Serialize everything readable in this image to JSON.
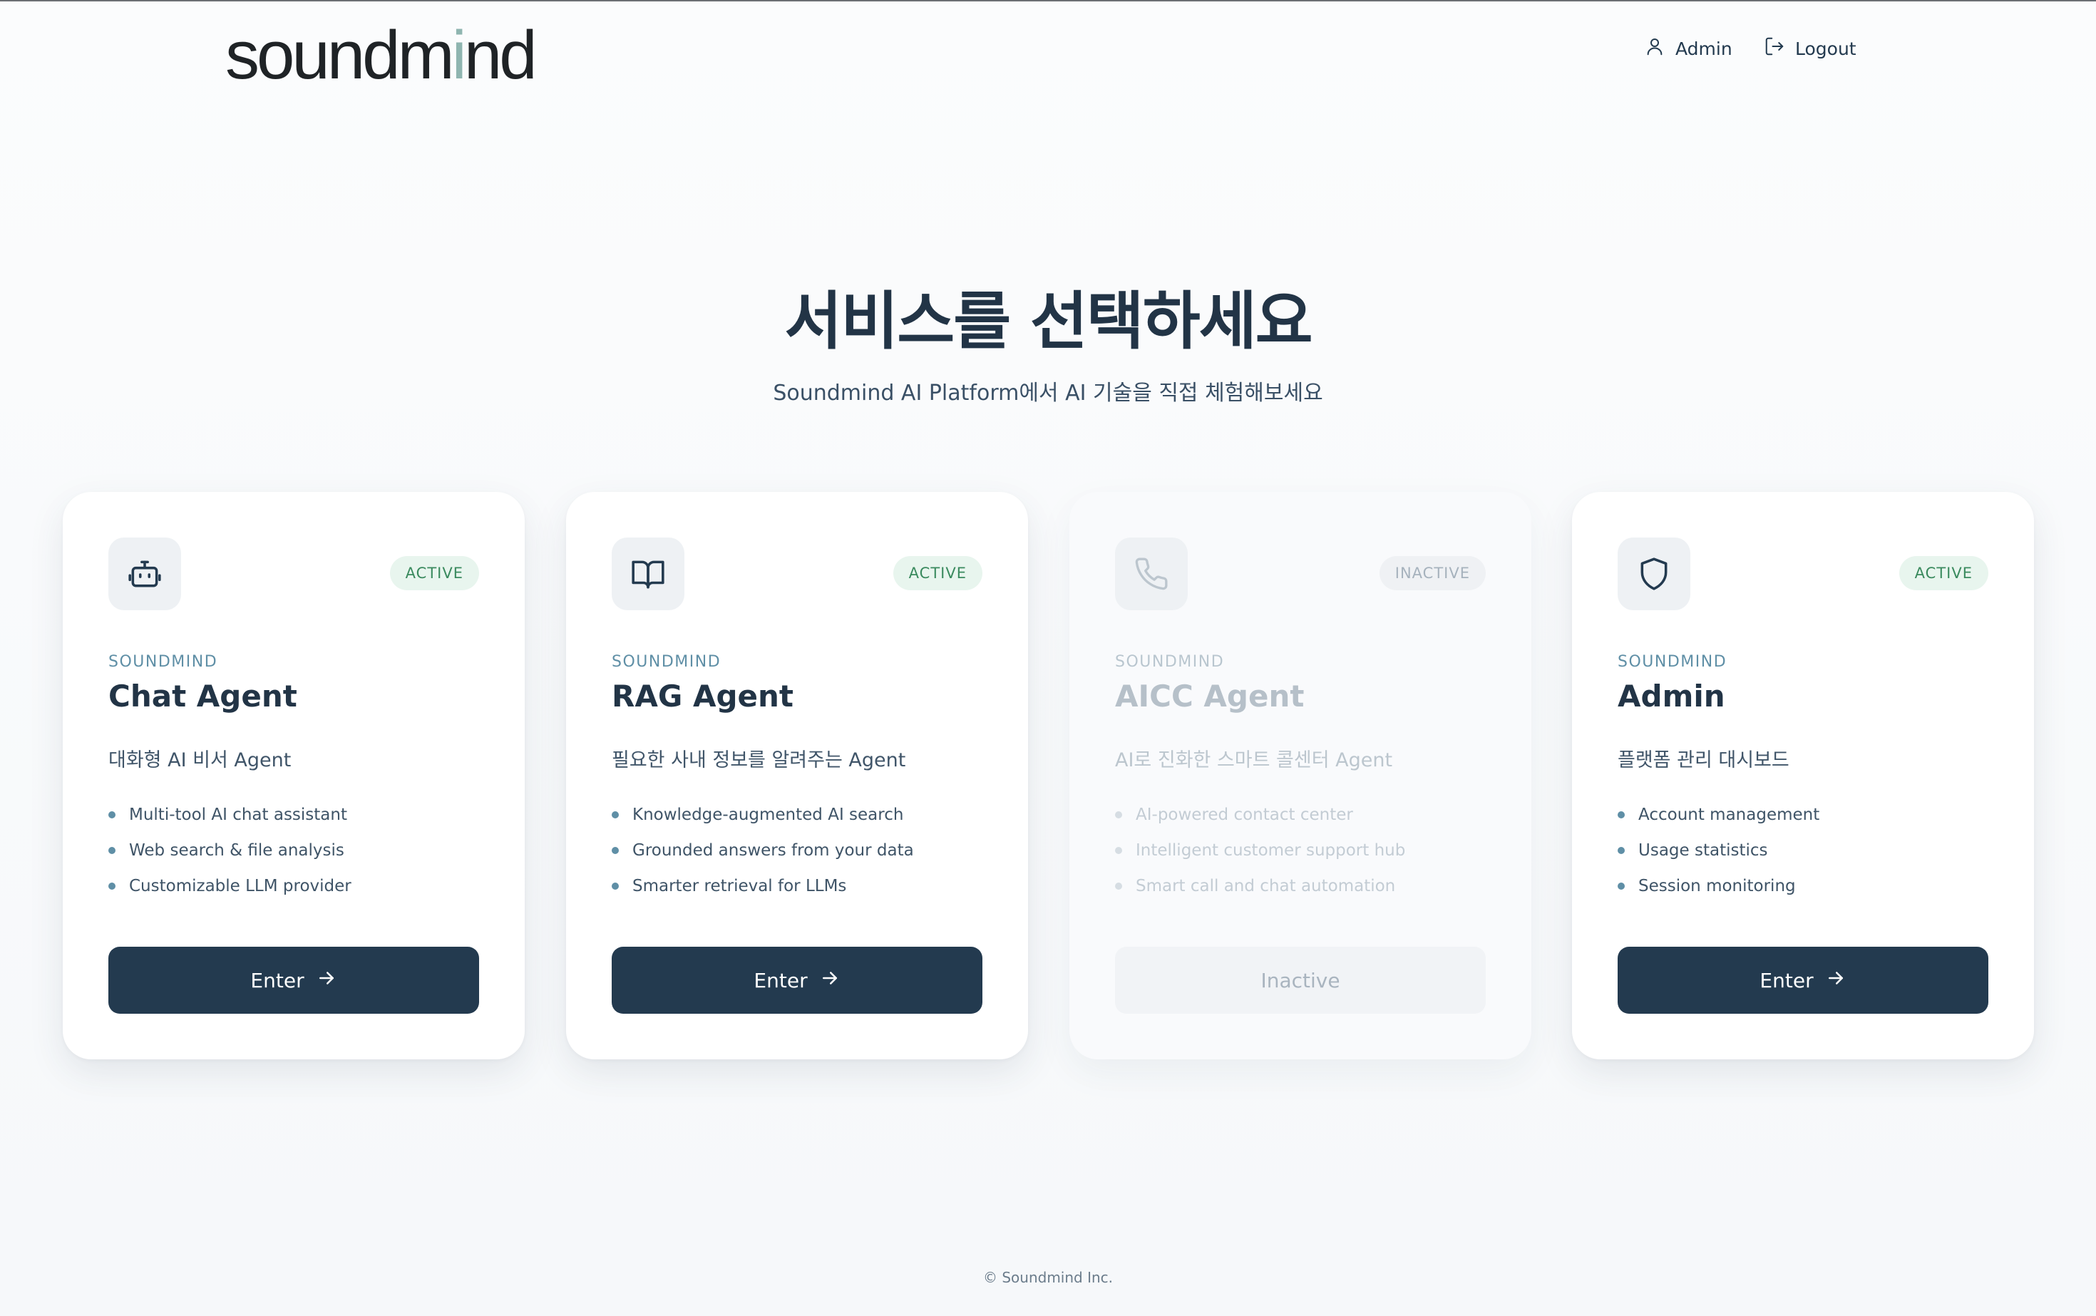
{
  "header": {
    "logo": {
      "part1": "soundm",
      "accent": "i",
      "part2": "nd"
    },
    "nav": {
      "admin": "Admin",
      "logout": "Logout"
    }
  },
  "hero": {
    "title": "서비스를 선택하세요",
    "subtitle": "Soundmind AI Platform에서 AI 기술을 직접 체험해보세요"
  },
  "cards": [
    {
      "icon": "robot-icon",
      "status": "ACTIVE",
      "eyebrow": "SOUNDMIND",
      "title": "Chat Agent",
      "description": "대화형 AI 비서 Agent",
      "features": [
        "Multi-tool AI chat assistant",
        "Web search & file analysis",
        "Customizable LLM provider"
      ],
      "button": "Enter"
    },
    {
      "icon": "book-icon",
      "status": "ACTIVE",
      "eyebrow": "SOUNDMIND",
      "title": "RAG Agent",
      "description": "필요한 사내 정보를 알려주는 Agent",
      "features": [
        "Knowledge-augmented AI search",
        "Grounded answers from your data",
        "Smarter retrieval for LLMs"
      ],
      "button": "Enter"
    },
    {
      "icon": "phone-icon",
      "status": "INACTIVE",
      "eyebrow": "SOUNDMIND",
      "title": "AICC Agent",
      "description": "AI로 진화한 스마트 콜센터 Agent",
      "features": [
        "AI-powered contact center",
        "Intelligent customer support hub",
        "Smart call and chat automation"
      ],
      "button": "Inactive"
    },
    {
      "icon": "shield-icon",
      "status": "ACTIVE",
      "eyebrow": "SOUNDMIND",
      "title": "Admin",
      "description": "플랫폼 관리 대시보드",
      "features": [
        "Account management",
        "Usage statistics",
        "Session monitoring"
      ],
      "button": "Enter"
    }
  ],
  "footer": {
    "copyright": "© Soundmind Inc."
  },
  "colors": {
    "primary": "#233a4f",
    "accent": "#5f8fa6",
    "active_badge": "#e8f5ee",
    "logo_accent": "#8fb5b0"
  }
}
